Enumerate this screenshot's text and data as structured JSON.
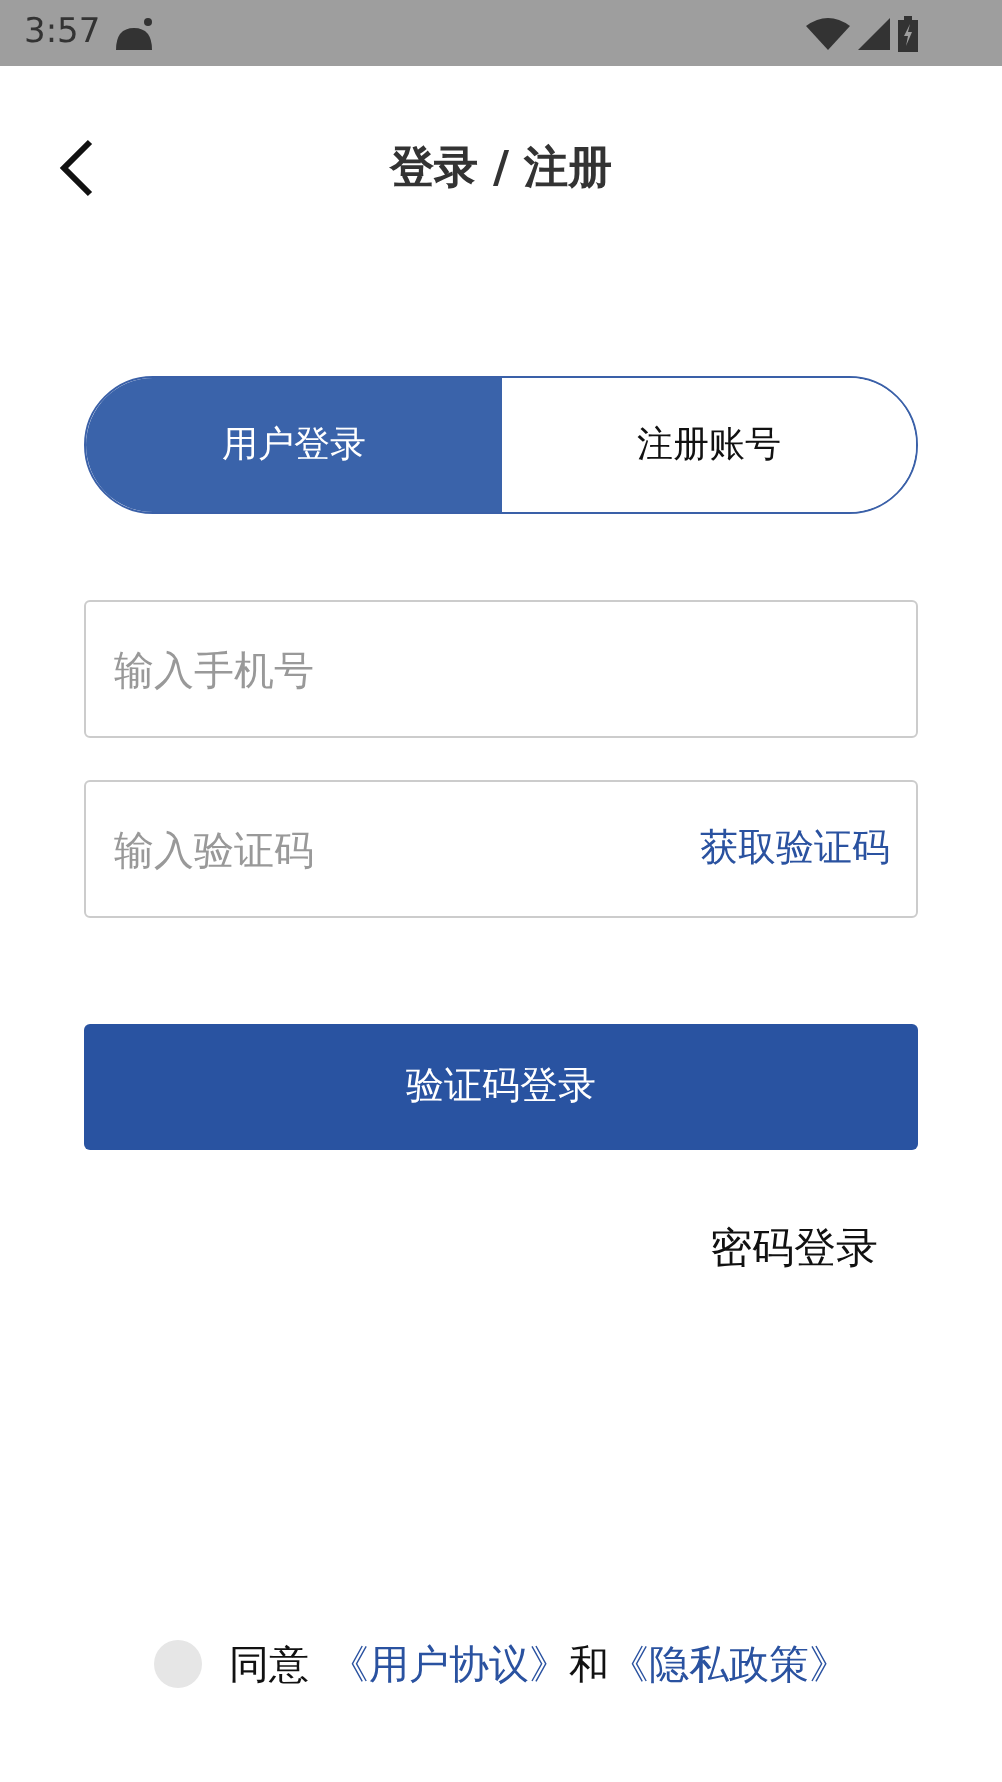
{
  "status_bar": {
    "time": "3:57"
  },
  "header": {
    "title": "登录 / 注册"
  },
  "tabs": [
    {
      "label": "用户登录",
      "selected": true
    },
    {
      "label": "注册账号",
      "selected": false
    }
  ],
  "phone_field": {
    "placeholder": "输入手机号"
  },
  "code_field": {
    "placeholder": "输入验证码",
    "action": "获取验证码"
  },
  "login_button": "验证码登录",
  "password_login": "密码登录",
  "agreement": {
    "checked": false,
    "prefix": "同意",
    "link_1": "《用户协议》",
    "and": "和",
    "link_2": "《隐私政策》"
  }
}
